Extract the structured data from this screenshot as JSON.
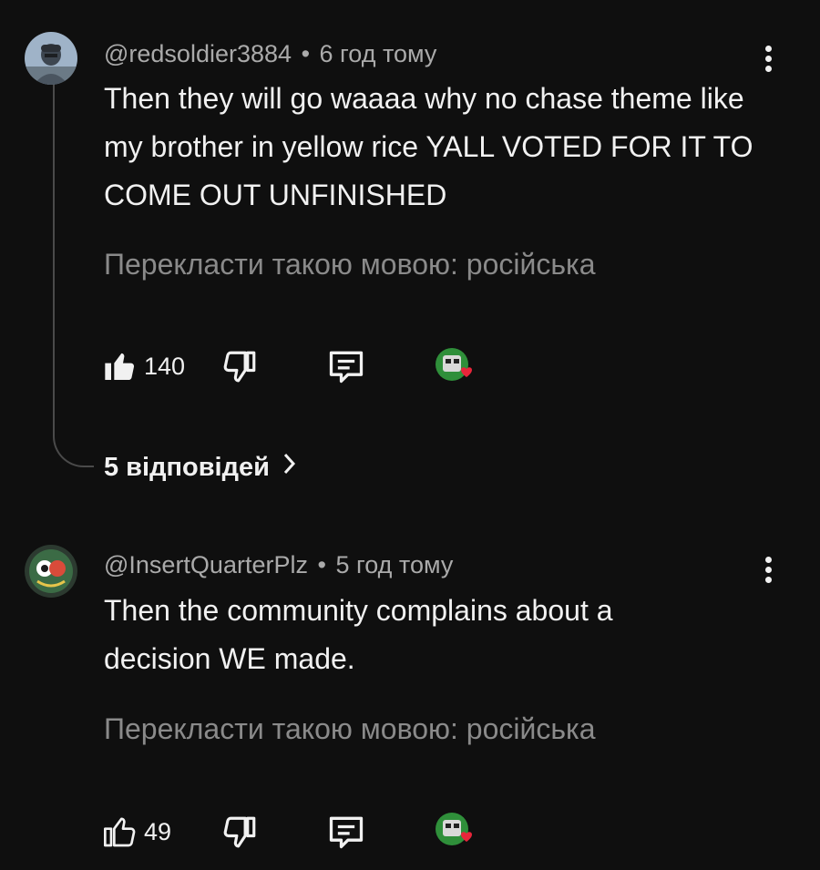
{
  "comments": [
    {
      "author": "@redsoldier3884",
      "separator": "•",
      "time": "6 год тому",
      "text": "Then they will go waaaa why no chase theme like my brother in yellow rice YALL VOTED FOR IT TO COME OUT UNFINISHED",
      "translate": "Перекласти такою мовою: російська",
      "likes": "140",
      "like_filled": true,
      "replies_label": "5 відповідей"
    },
    {
      "author": "@InsertQuarterPlz",
      "separator": "•",
      "time": "5 год тому",
      "text": "Then the community complains about a decision WE made.",
      "translate": "Перекласти такою мовою: російська",
      "likes": "49",
      "like_filled": false
    }
  ],
  "colors": {
    "background": "#0f0f0f",
    "text": "#f1f1f1",
    "meta": "#aaaaaa",
    "translate": "#8a8a8a",
    "heart": "#e8253a"
  },
  "icons": [
    "more-vertical-icon",
    "thumbs-up-icon",
    "thumbs-down-icon",
    "reply-icon",
    "creator-heart-icon",
    "chevron-right-icon"
  ]
}
